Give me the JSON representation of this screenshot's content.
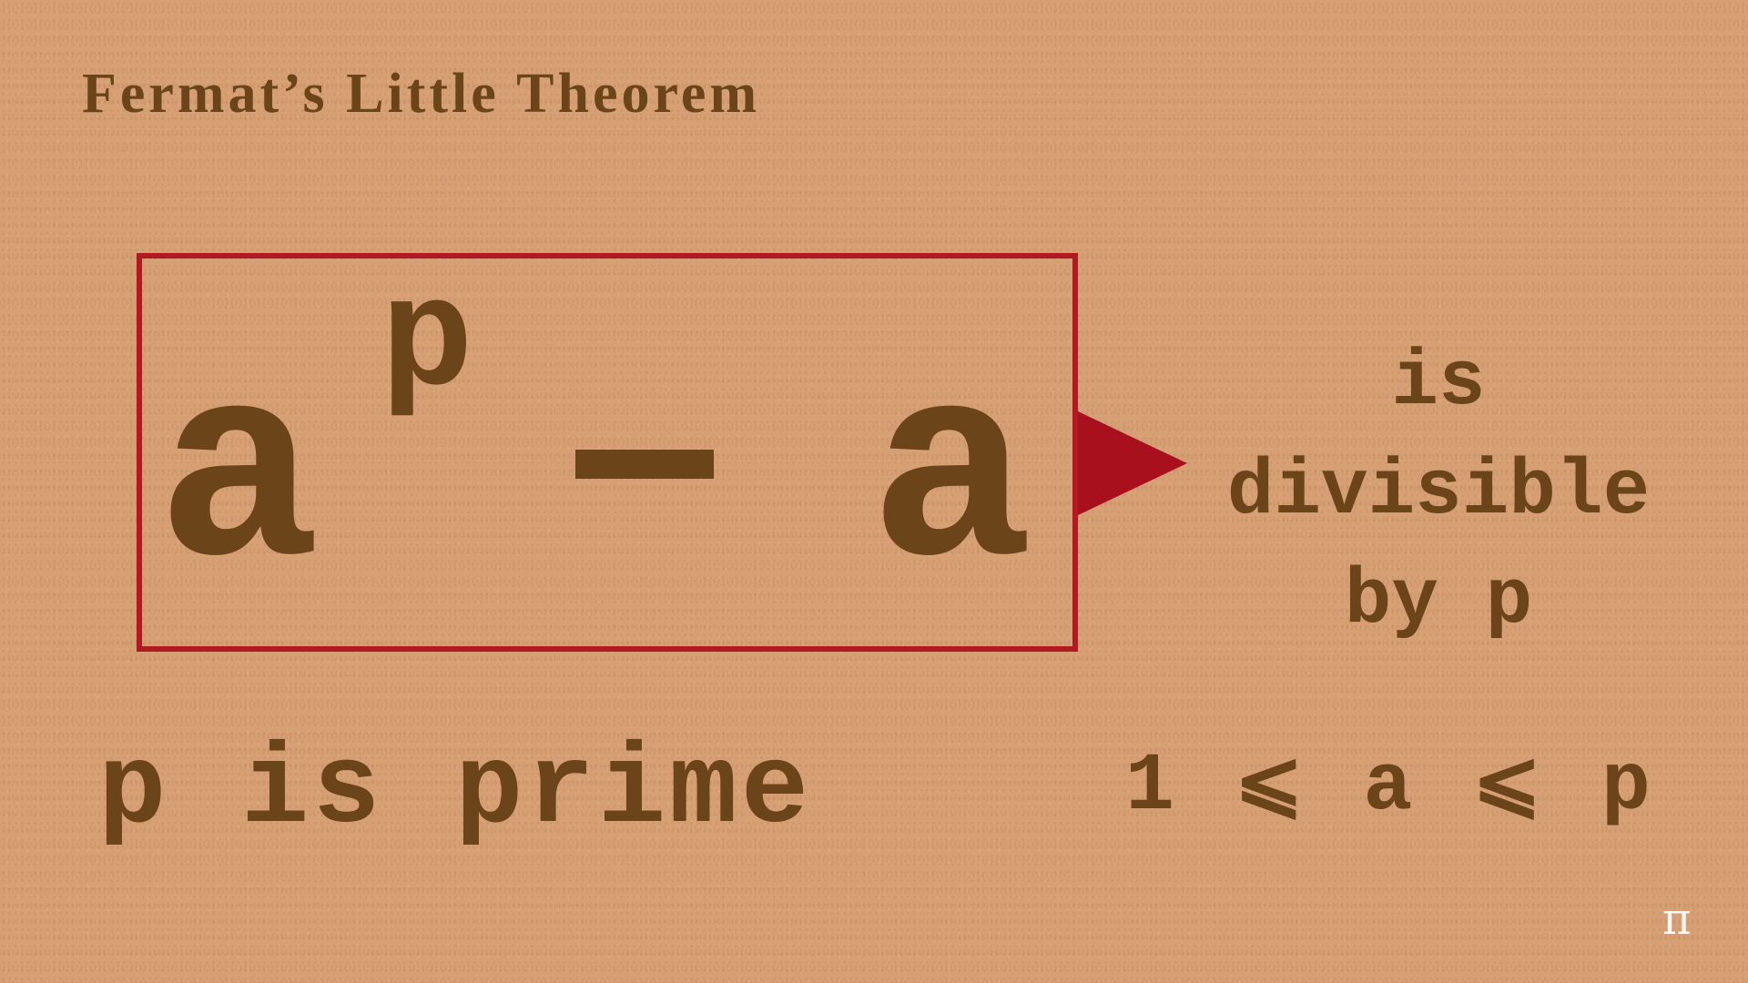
{
  "title": "Fermat’s Little Theorem",
  "formula": {
    "base": "a",
    "exponent": "p",
    "operator": "−",
    "rhs": "a"
  },
  "conclusion": {
    "line1": "is",
    "line2": "divisible",
    "line3": "by p"
  },
  "condition_prime": "p is prime",
  "condition_range": "1 ⩽ a ⩽ p",
  "logo": "π",
  "colors": {
    "background": "#d79f74",
    "text": "#6b4519",
    "box": "#b01a22",
    "arrow": "#a8101e"
  }
}
